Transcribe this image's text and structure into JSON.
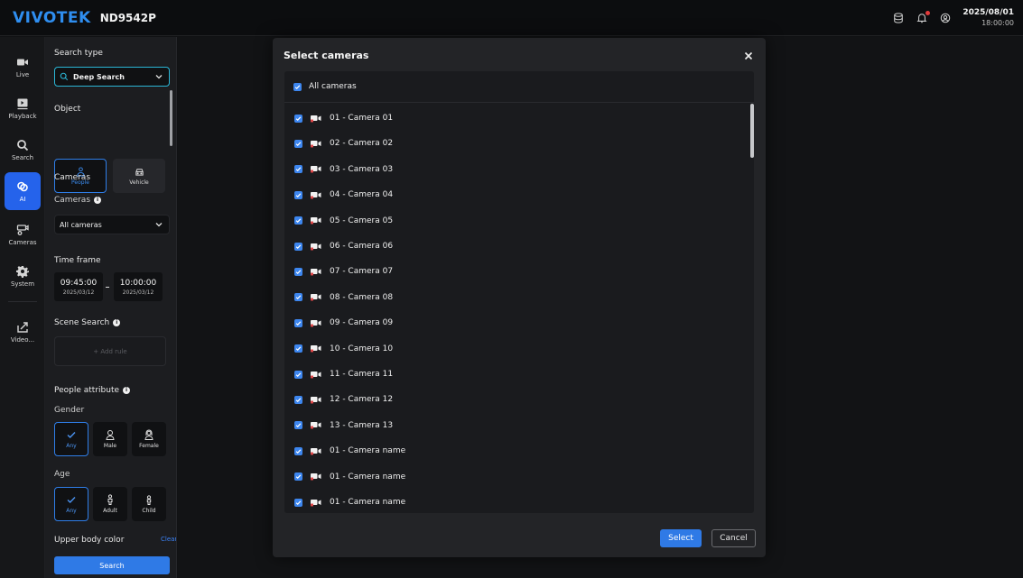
{
  "header": {
    "brand": "VIVOTEK",
    "model": "ND9542P",
    "date": "2025/08/01",
    "time": "18:00:00",
    "icons": [
      "storage-icon",
      "notification-bell-icon",
      "user-account-icon"
    ],
    "notification_dot_color": "#e23b3b"
  },
  "nav": {
    "items": [
      {
        "label": "Live",
        "icon": "video-camera-icon"
      },
      {
        "label": "Playback",
        "icon": "playback-icon"
      },
      {
        "label": "Search",
        "icon": "search-icon"
      },
      {
        "label": "AI",
        "icon": "ai-icon",
        "active": true
      },
      {
        "label": "Cameras",
        "icon": "cameras-icon"
      },
      {
        "label": "System",
        "icon": "gear-icon"
      },
      {
        "label": "Video...",
        "icon": "export-icon"
      }
    ],
    "active_color": "#2563eb"
  },
  "panel": {
    "search_type_label": "Search type",
    "search_type_value": "Deep Search",
    "object_label": "Object",
    "objects": [
      {
        "label": "People",
        "selected": true
      },
      {
        "label": "Vehicle",
        "selected": false
      }
    ],
    "cameras_heading": "Cameras",
    "cameras_sublabel": "Cameras",
    "cameras_value": "All cameras",
    "time_frame_label": "Time frame",
    "time_start": {
      "time": "09:45:00",
      "date": "2025/03/12"
    },
    "time_end": {
      "time": "10:00:00",
      "date": "2025/03/12"
    },
    "scene_search_label": "Scene Search",
    "add_rule_label": "+ Add rule",
    "people_attribute_label": "People attribute",
    "gender_label": "Gender",
    "gender_options": [
      {
        "label": "Any",
        "selected": true
      },
      {
        "label": "Male",
        "selected": false
      },
      {
        "label": "Female",
        "selected": false
      }
    ],
    "age_label": "Age",
    "age_options": [
      {
        "label": "Any",
        "selected": true
      },
      {
        "label": "Adult",
        "selected": false
      },
      {
        "label": "Child",
        "selected": false
      }
    ],
    "upper_body_color_label": "Upper body color",
    "clear_label": "Clear",
    "search_button": "Search",
    "accent_color": "#2f7ae6",
    "deep_search_border_color": "#2bb6d6"
  },
  "modal": {
    "title": "Select cameras",
    "all_cameras_label": "All cameras",
    "all_cameras_checked": true,
    "cameras": [
      {
        "label": "01 - Camera 01",
        "checked": true
      },
      {
        "label": "02 - Camera 02",
        "checked": true
      },
      {
        "label": "03 - Camera 03",
        "checked": true
      },
      {
        "label": "04 - Camera 04",
        "checked": true
      },
      {
        "label": "05 - Camera 05",
        "checked": true
      },
      {
        "label": "06 - Camera 06",
        "checked": true
      },
      {
        "label": "07 - Camera 07",
        "checked": true
      },
      {
        "label": "08 - Camera 08",
        "checked": true
      },
      {
        "label": "09 - Camera 09",
        "checked": true
      },
      {
        "label": "10 - Camera 10",
        "checked": true
      },
      {
        "label": "11 - Camera 11",
        "checked": true
      },
      {
        "label": "12 - Camera 12",
        "checked": true
      },
      {
        "label": "13 - Camera 13",
        "checked": true
      },
      {
        "label": "01 - Camera name",
        "checked": true
      },
      {
        "label": "01 - Camera name",
        "checked": true
      },
      {
        "label": "01 - Camera name",
        "checked": true
      }
    ],
    "select_button": "Select",
    "cancel_button": "Cancel",
    "checkbox_color": "#3d86ef"
  }
}
